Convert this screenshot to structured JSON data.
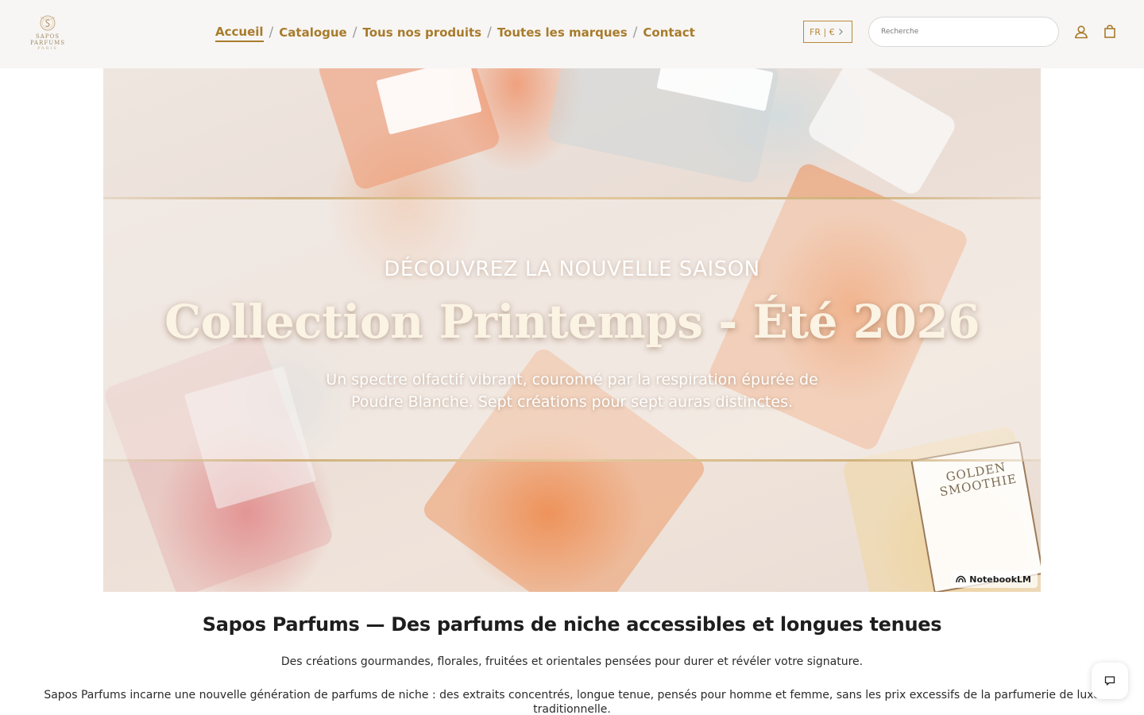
{
  "brand": {
    "logo_text": "SAPOS PARFUMS",
    "logo_sub": "PARIS"
  },
  "nav": {
    "items": [
      {
        "label": "Accueil",
        "active": true
      },
      {
        "label": "Catalogue",
        "active": false
      },
      {
        "label": "Tous nos produits",
        "active": false
      },
      {
        "label": "Toutes les marques",
        "active": false
      },
      {
        "label": "Contact",
        "active": false
      }
    ],
    "separator": "/"
  },
  "header": {
    "locale_label": "FR | €",
    "search_placeholder": "Recherche",
    "icons": [
      "account-icon",
      "cart-icon"
    ]
  },
  "hero": {
    "eyebrow": "DÉCOUVREZ LA NOUVELLE SAISON",
    "title": "Collection Printemps - Été 2026",
    "subtitle_line1": "Un spectre olfactif vibrant, couronné par la respiration épurée de",
    "subtitle_line2": "Poudre Blanche. Sept créations pour sept auras distinctes.",
    "bottle_label": "GOLDEN SMOOTHIE",
    "watermark": "NotebookLM"
  },
  "intro": {
    "title": "Sapos Parfums — Des parfums de niche accessibles et longues tenues",
    "subtitle": "Des créations gourmandes, florales, fruitées et orientales pensées pour durer et révéler votre signature.",
    "body": "Sapos Parfums incarne une nouvelle génération de parfums de niche : des extraits concentrés, longue tenue, pensés pour homme et femme, sans les prix excessifs de la parfumerie de luxe traditionnelle."
  },
  "colors": {
    "accent": "#a87b2c",
    "header_bg": "#f7f6f4",
    "text": "#1e1e1e"
  }
}
